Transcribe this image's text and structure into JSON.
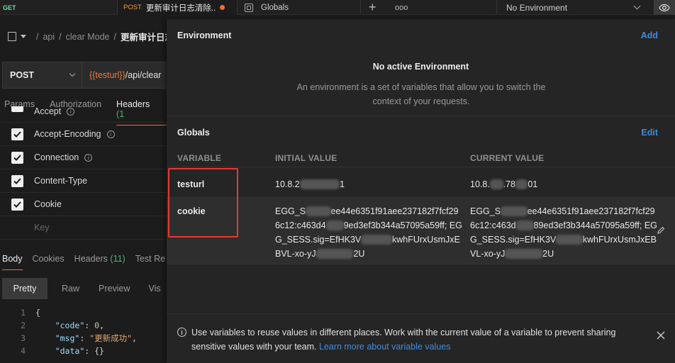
{
  "tabs": {
    "get_method": "GET",
    "post_method": "POST",
    "post_title": "更新审计日志清除...",
    "globals_label": "Globals",
    "plus": "+",
    "more": "ooo"
  },
  "env_selector": {
    "label": "No Environment"
  },
  "breadcrumb": {
    "seg1": "api",
    "seg2": "clear Mode",
    "current": "更新审计日志清"
  },
  "request": {
    "method": "POST",
    "url_var": "{{testurl}}",
    "url_path": "/api/clear"
  },
  "req_tabs": {
    "params": "Params",
    "authorization": "Authorization",
    "headers": "Headers",
    "headers_count": "(1"
  },
  "headers": [
    {
      "name": "Accept",
      "info": true
    },
    {
      "name": "Accept-Encoding",
      "info": true
    },
    {
      "name": "Connection",
      "info": true
    },
    {
      "name": "Content-Type",
      "info": false
    },
    {
      "name": "Cookie",
      "info": false
    }
  ],
  "headers_key_placeholder": "Key",
  "resp_tabs": {
    "body": "Body",
    "cookies": "Cookies",
    "headers": "Headers",
    "headers_count": "(11)",
    "test_results": "Test Re"
  },
  "fmt_tabs": {
    "pretty": "Pretty",
    "raw": "Raw",
    "preview": "Preview",
    "visualize": "Vis"
  },
  "code_lines": {
    "l1": "{",
    "l2_key": "\"code\"",
    "l2_val": "0",
    "l3_key": "\"msg\"",
    "l3_val": "\"更新成功\"",
    "l4_key": "\"data\"",
    "l4_val": "{}"
  },
  "env_panel": {
    "title": "Environment",
    "add": "Add",
    "no_env_title": "No active Environment",
    "no_env_desc": "An environment is a set of variables that allow you to switch the context of your requests.",
    "globals_title": "Globals",
    "edit": "Edit",
    "col_variable": "VARIABLE",
    "col_initial": "INITIAL VALUE",
    "col_current": "CURRENT VALUE",
    "rows": [
      {
        "name": "testurl",
        "initial": "10.8.2",
        "initial_tail": "1",
        "current": "10.8.",
        "current_mid": ".78",
        "current_tail": "01"
      },
      {
        "name": "cookie",
        "initial": "EGG_S",
        "initial_rest": "ee44e6351f91aee237182f7fcf296c12:c463d4",
        "initial_rest2": "9ed3ef3b344a57095a59ff; EGG_SESS.sig=EfHK3V",
        "initial_rest3": "kwhFUrxUsmJxEBVL-xo-yJ",
        "initial_end": "2U",
        "current": "EGG_S",
        "current_rest": "ee44e6351f91aee237182f7fcf296c12:c463d",
        "current_rest2": "89ed3ef3b344a57095a59ff; EGG_SESS.sig=EfHK3V",
        "current_rest3": "kwhFUrxUsmJxEBVL-xo-yJ",
        "current_end": "2U"
      }
    ],
    "footer_text": "Use variables to reuse values in different places. Work with the current value of a variable to prevent sharing sensitive values with your team.",
    "footer_link": "Learn more about variable values"
  },
  "colors": {
    "accent_orange": "#f26b3a",
    "link_blue": "#3f8cdc",
    "highlight_red": "#e53935",
    "get_green": "#6bdd9a"
  }
}
